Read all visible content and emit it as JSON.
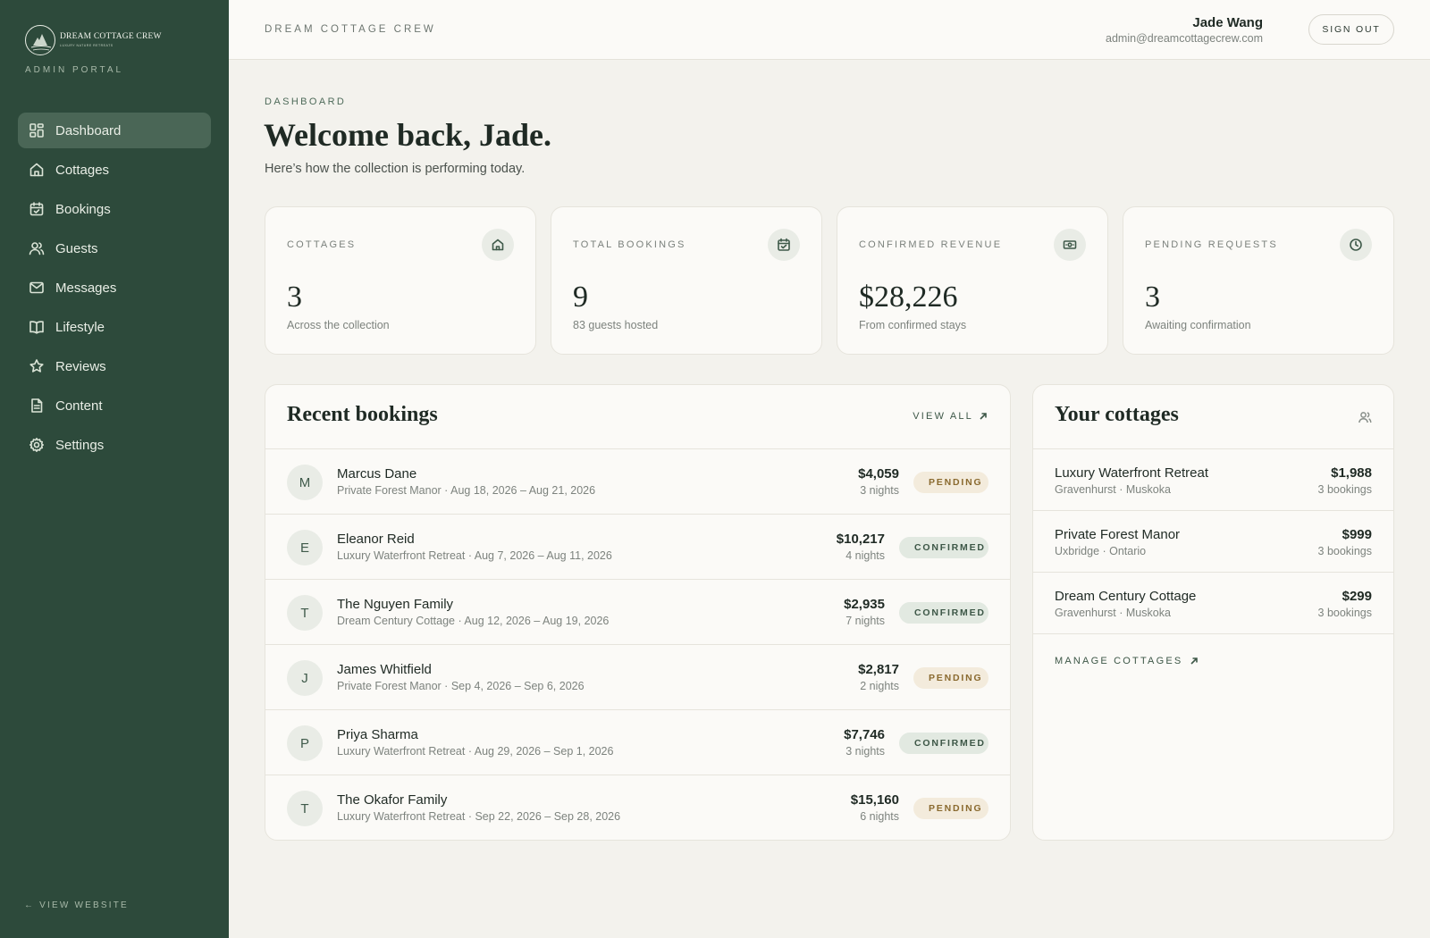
{
  "sidebar": {
    "brand_name": "DREAM COTTAGE CREW",
    "brand_tagline": "LUXURY NATURE RETREATS",
    "portal_label": "ADMIN PORTAL",
    "items": [
      {
        "label": "Dashboard",
        "icon": "dashboard-icon",
        "active": true
      },
      {
        "label": "Cottages",
        "icon": "home-icon"
      },
      {
        "label": "Bookings",
        "icon": "calendar-icon"
      },
      {
        "label": "Guests",
        "icon": "users-icon"
      },
      {
        "label": "Messages",
        "icon": "mail-icon"
      },
      {
        "label": "Lifestyle",
        "icon": "book-icon"
      },
      {
        "label": "Reviews",
        "icon": "star-icon"
      },
      {
        "label": "Content",
        "icon": "document-icon"
      },
      {
        "label": "Settings",
        "icon": "gear-icon"
      }
    ],
    "view_website": "← VIEW WEBSITE"
  },
  "header": {
    "brand": "DREAM COTTAGE CREW",
    "user_name": "Jade Wang",
    "user_email": "admin@dreamcottagecrew.com",
    "sign_out": "SIGN OUT"
  },
  "main": {
    "eyebrow": "DASHBOARD",
    "welcome": "Welcome back, Jade.",
    "subtitle": "Here’s how the collection is performing today."
  },
  "stats": [
    {
      "label": "COTTAGES",
      "value": "3",
      "sub": "Across the collection",
      "icon": "home-icon"
    },
    {
      "label": "TOTAL BOOKINGS",
      "value": "9",
      "sub": "83 guests hosted",
      "icon": "calendar-check-icon"
    },
    {
      "label": "CONFIRMED REVENUE",
      "value": "$28,226",
      "sub": "From confirmed stays",
      "icon": "cash-icon"
    },
    {
      "label": "PENDING REQUESTS",
      "value": "3",
      "sub": "Awaiting confirmation",
      "icon": "clock-icon"
    }
  ],
  "recent_bookings": {
    "title": "Recent bookings",
    "view_all": "VIEW ALL",
    "rows": [
      {
        "initial": "M",
        "name": "Marcus Dane",
        "detail": "Private Forest Manor · Aug 18, 2026 – Aug 21, 2026",
        "amount": "$4,059",
        "nights": "3 nights",
        "status": "PENDING"
      },
      {
        "initial": "E",
        "name": "Eleanor Reid",
        "detail": "Luxury Waterfront Retreat · Aug 7, 2026 – Aug 11, 2026",
        "amount": "$10,217",
        "nights": "4 nights",
        "status": "CONFIRMED"
      },
      {
        "initial": "T",
        "name": "The Nguyen Family",
        "detail": "Dream Century Cottage · Aug 12, 2026 – Aug 19, 2026",
        "amount": "$2,935",
        "nights": "7 nights",
        "status": "CONFIRMED"
      },
      {
        "initial": "J",
        "name": "James Whitfield",
        "detail": "Private Forest Manor · Sep 4, 2026 – Sep 6, 2026",
        "amount": "$2,817",
        "nights": "2 nights",
        "status": "PENDING"
      },
      {
        "initial": "P",
        "name": "Priya Sharma",
        "detail": "Luxury Waterfront Retreat · Aug 29, 2026 – Sep 1, 2026",
        "amount": "$7,746",
        "nights": "3 nights",
        "status": "CONFIRMED"
      },
      {
        "initial": "T",
        "name": "The Okafor Family",
        "detail": "Luxury Waterfront Retreat · Sep 22, 2026 – Sep 28, 2026",
        "amount": "$15,160",
        "nights": "6 nights",
        "status": "PENDING"
      }
    ]
  },
  "your_cottages": {
    "title": "Your cottages",
    "rows": [
      {
        "name": "Luxury Waterfront Retreat",
        "location": "Gravenhurst · Muskoka",
        "price": "$1,988",
        "bookings": "3 bookings"
      },
      {
        "name": "Private Forest Manor",
        "location": "Uxbridge · Ontario",
        "price": "$999",
        "bookings": "3 bookings"
      },
      {
        "name": "Dream Century Cottage",
        "location": "Gravenhurst · Muskoka",
        "price": "$299",
        "bookings": "3 bookings"
      }
    ],
    "manage": "MANAGE COTTAGES"
  },
  "colors": {
    "sidebar": "#2d4a3b",
    "accent": "#3d5747",
    "pending": "#b8893a",
    "background": "#f3f2ed"
  }
}
